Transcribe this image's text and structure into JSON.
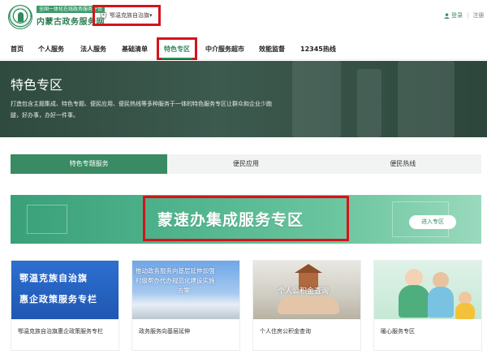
{
  "header": {
    "logo_tag": "全国一体化在线政务服务平台",
    "logo_title": "内蒙古政务服务网",
    "region": "鄂温克族自治旗▾",
    "login": "登录",
    "separator": "|",
    "register": "注册"
  },
  "nav": {
    "items": [
      "首页",
      "个人服务",
      "法人服务",
      "基础清单",
      "特色专区",
      "中介服务超市",
      "效能监督",
      "12345热线"
    ],
    "active_index": 4
  },
  "banner": {
    "title": "特色专区",
    "description": "打造包含主题集成、特色专题、便民应用、便民热线等多种服务于一体的特色服务专区让群众和企业少跑腿，好办事，办好一件事。"
  },
  "tabs": [
    "特色专题服务",
    "便民应用",
    "便民热线"
  ],
  "promo": {
    "title": "蒙速办集成服务专区",
    "button": "进入专区"
  },
  "cards": [
    {
      "label": "鄂温克族自治旗惠企政策服务专栏",
      "image_text": [
        "鄂温克族自治旗",
        "惠企政策服务专栏"
      ]
    },
    {
      "label": "政务服务向基层延伸",
      "image_text": [
        "推动政务服务向基层延伸加强",
        "村级帮办代办规范化建设实施",
        "方案"
      ]
    },
    {
      "label": "个人住房公积金查询",
      "image_text": [
        "个人公积金查询"
      ]
    },
    {
      "label": "暖心服务专区",
      "image_text": []
    }
  ],
  "colors": {
    "brand_green": "#2e8a5a",
    "highlight_red": "#d4141b",
    "banner_dark": "#33503f"
  }
}
